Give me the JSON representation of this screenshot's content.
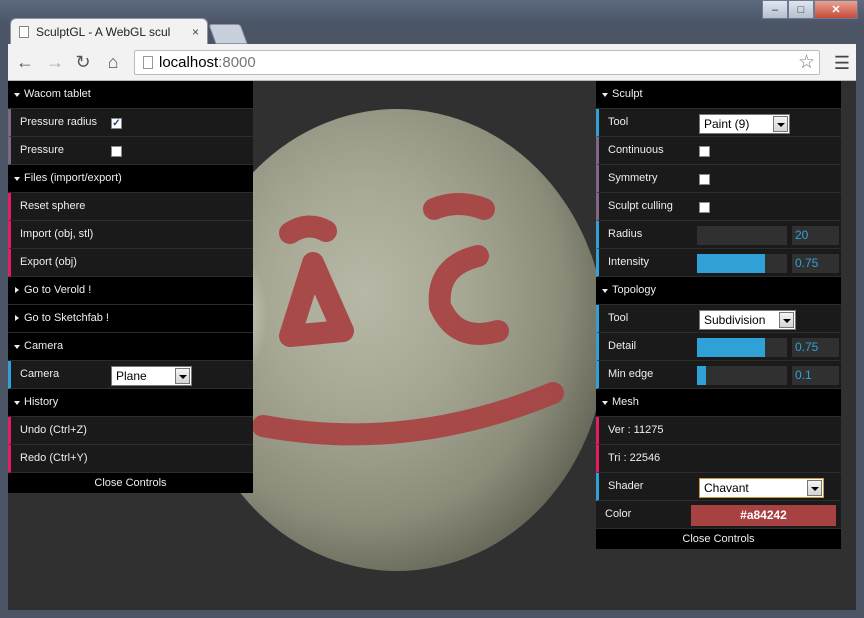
{
  "browser": {
    "tab_title": "SculptGL - A WebGL scul",
    "tab_close": "×",
    "url_host": "localhost",
    "url_port": ":8000",
    "window_buttons": {
      "minimize": "–",
      "maximize": "□",
      "close": "✕"
    }
  },
  "left_panel": {
    "wacom": {
      "title": "Wacom tablet",
      "pressure_radius": "Pressure radius",
      "pressure_radius_checked": true,
      "pressure": "Pressure",
      "pressure_checked": false
    },
    "files": {
      "title": "Files (import/export)",
      "reset": "Reset sphere",
      "import": "Import (obj, stl)",
      "export": "Export (obj)"
    },
    "verold": "Go to Verold !",
    "sketchfab": "Go to Sketchfab !",
    "camera": {
      "title": "Camera",
      "label": "Camera",
      "value": "Plane"
    },
    "history": {
      "title": "History",
      "undo": "Undo (Ctrl+Z)",
      "redo": "Redo (Ctrl+Y)"
    },
    "close": "Close Controls"
  },
  "right_panel": {
    "sculpt": {
      "title": "Sculpt",
      "tool_label": "Tool",
      "tool_value": "Paint (9)",
      "continuous": "Continuous",
      "continuous_checked": false,
      "symmetry": "Symmetry",
      "symmetry_checked": false,
      "culling": "Sculpt culling",
      "culling_checked": false,
      "radius_label": "Radius",
      "radius_value": "20",
      "radius_fraction": 0.0,
      "intensity_label": "Intensity",
      "intensity_value": "0.75",
      "intensity_fraction": 0.75
    },
    "topology": {
      "title": "Topology",
      "tool_label": "Tool",
      "tool_value": "Subdivision",
      "detail_label": "Detail",
      "detail_value": "0.75",
      "detail_fraction": 0.75,
      "minedge_label": "Min edge",
      "minedge_value": "0.1",
      "minedge_fraction": 0.1
    },
    "mesh": {
      "title": "Mesh",
      "vertices": "Ver : 11275",
      "triangles": "Tri : 22546",
      "shader_label": "Shader",
      "shader_value": "Chavant",
      "color_label": "Color",
      "color_value": "#a84242"
    },
    "close": "Close Controls"
  },
  "colors": {
    "paint": "#a84242",
    "accent": "#2fa1d6"
  }
}
